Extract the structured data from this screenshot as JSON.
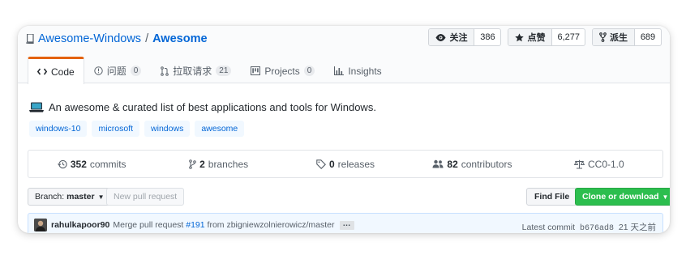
{
  "repo": {
    "owner": "Awesome-Windows",
    "separator": "/",
    "name": "Awesome"
  },
  "actions": [
    {
      "label": "关注",
      "count": "386",
      "icon": "eye-icon"
    },
    {
      "label": "点赞",
      "count": "6,277",
      "icon": "star-icon"
    },
    {
      "label": "派生",
      "count": "689",
      "icon": "fork-icon"
    }
  ],
  "tabs": [
    {
      "label": "Code",
      "counter": "",
      "icon": "code-icon",
      "selected": true
    },
    {
      "label": "问题",
      "counter": "0",
      "icon": "issue-icon"
    },
    {
      "label": "拉取请求",
      "counter": "21",
      "icon": "pull-request-icon"
    },
    {
      "label": "Projects",
      "counter": "0",
      "icon": "project-icon"
    },
    {
      "label": "Insights",
      "counter": "",
      "icon": "graph-icon"
    }
  ],
  "description": "An awesome & curated list of best applications and tools for Windows.",
  "topics": [
    "windows-10",
    "microsoft",
    "windows",
    "awesome"
  ],
  "summary": [
    {
      "num": "352",
      "label": "commits",
      "icon": "history-icon"
    },
    {
      "num": "2",
      "label": "branches",
      "icon": "branch-icon"
    },
    {
      "num": "0",
      "label": "releases",
      "icon": "tag-icon"
    },
    {
      "num": "82",
      "label": "contributors",
      "icon": "people-icon"
    },
    {
      "num": "",
      "label": "CC0-1.0",
      "icon": "law-icon"
    }
  ],
  "toolbar": {
    "branch_label": "Branch:",
    "branch_name": "master",
    "new_pr": "New pull request",
    "find_file": "Find File",
    "clone": "Clone or download"
  },
  "commit": {
    "author": "rahulkapoor90",
    "message_prefix": "Merge pull request",
    "pr_number": "#191",
    "message_suffix": "from zbigniewzolnierowicz/master",
    "ellipsis": "…",
    "latest_label": "Latest commit",
    "sha": "b676ad8",
    "time": "21 天之前"
  },
  "colors": {
    "link": "#0366d6",
    "tab_accent": "#e36209",
    "clone_green": "#2cbe4e"
  }
}
